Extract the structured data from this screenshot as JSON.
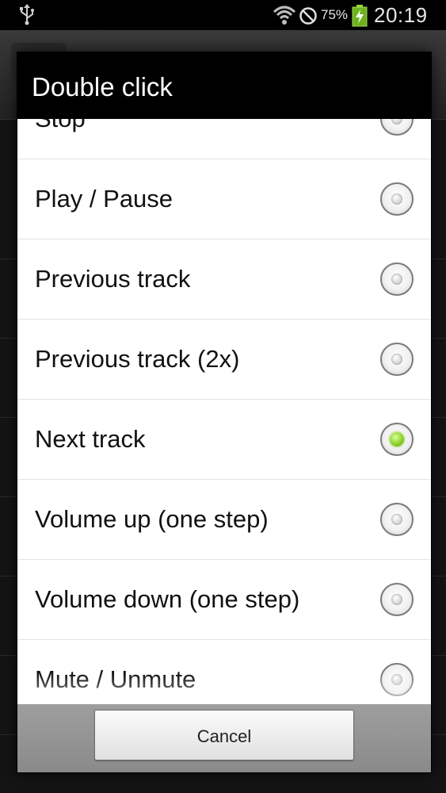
{
  "status_bar": {
    "icons": [
      "usb-icon",
      "wifi-icon",
      "no-signal-icon",
      "battery-charging-icon"
    ],
    "battery_percent": "75%",
    "time": "20:19"
  },
  "dialog": {
    "title": "Double click",
    "options": [
      {
        "label": "Stop",
        "selected": false
      },
      {
        "label": "Play / Pause",
        "selected": false
      },
      {
        "label": "Previous track",
        "selected": false
      },
      {
        "label": "Previous track (2x)",
        "selected": false
      },
      {
        "label": "Next track",
        "selected": true
      },
      {
        "label": "Volume up (one step)",
        "selected": false
      },
      {
        "label": "Volume down (one step)",
        "selected": false
      },
      {
        "label": "Mute / Unmute",
        "selected": false
      }
    ],
    "cancel_label": "Cancel"
  },
  "colors": {
    "title_bar": "#000000",
    "selected_radio": "#8fd12a",
    "button_bar": "#9e9e9e"
  }
}
